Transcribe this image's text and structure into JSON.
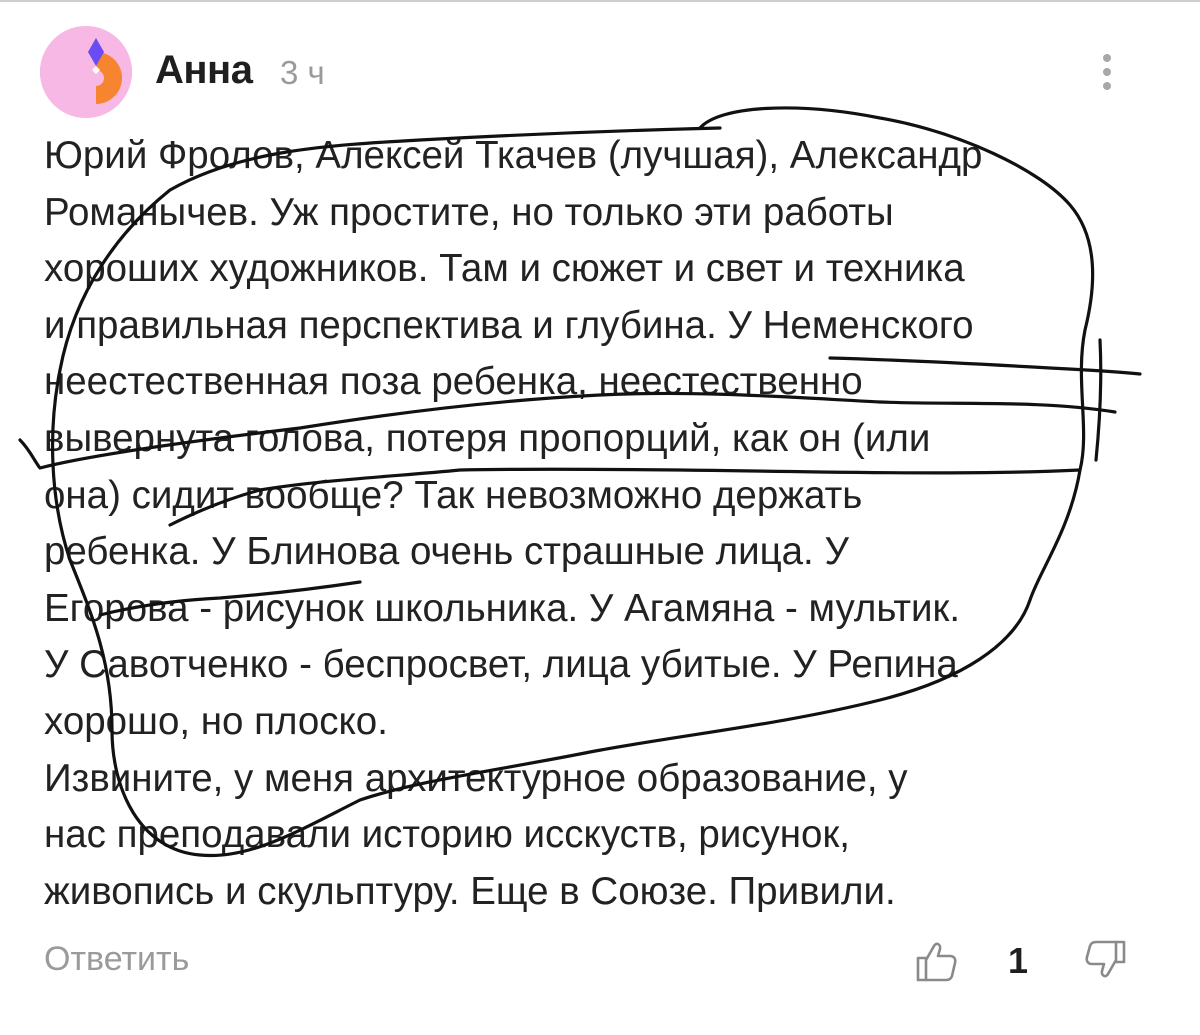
{
  "comment": {
    "author": "Анна",
    "time": "3 ч",
    "lines": [
      "Юрий Фролов, Алексей Ткачев (лучшая), Александр",
      "Романычев. Уж простите, но только эти работы",
      "хороших художников. Там и сюжет и свет и техника",
      "и правильная перспектива и глубина. У Неменского",
      "неестественная поза ребенка, неестественно",
      "вывернута голова, потеря пропорций, как он (или",
      "она) сидит вообще? Так невозможно держать",
      "ребенка. У Блинова очень страшные лица. У",
      "Егорова - рисунок школьника. У Агамяна - мультик.",
      "У Савотченко - беспросвет, лица убитые. У Репина",
      "хорошо, но плоско.",
      "Извините, у меня архитектурное образование, у",
      "нас преподавали историю исскуств, рисунок,",
      "живопись и скульптуру. Еще в Союзе. Привили."
    ],
    "reply_label": "Ответить",
    "like_count": "1"
  },
  "icons": {
    "menu": "more-vertical-icon",
    "like": "thumbs-up-icon",
    "dislike": "thumbs-down-icon"
  },
  "colors": {
    "avatar_pink": "#f7b8e6",
    "avatar_orange": "#f7842e",
    "avatar_purple": "#6a4cf5",
    "ink": "#111111",
    "muted": "#9a9a9a"
  }
}
